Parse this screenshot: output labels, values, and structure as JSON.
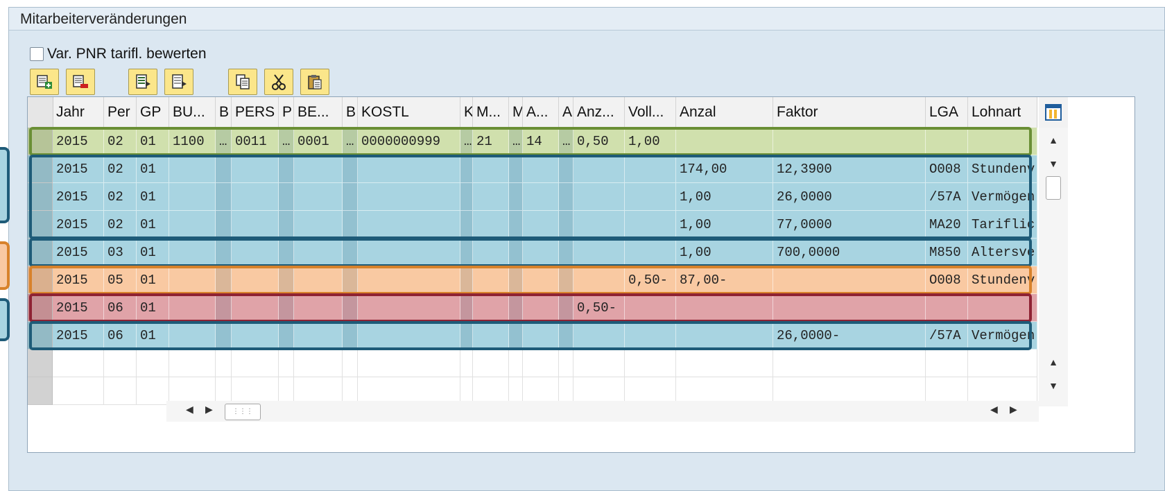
{
  "window": {
    "title": "Mitarbeiterveränderungen"
  },
  "checkbox": {
    "label": "Var. PNR tarifl. bewerten",
    "checked": false
  },
  "toolbar": {
    "buttons": [
      {
        "name": "append-row-icon"
      },
      {
        "name": "delete-row-icon"
      },
      {
        "name": "select-all-icon"
      },
      {
        "name": "deselect-all-icon"
      },
      {
        "name": "copy-icon"
      },
      {
        "name": "cut-icon"
      },
      {
        "name": "paste-icon"
      }
    ]
  },
  "table": {
    "headers": [
      "Jahr",
      "Per",
      "GP",
      "BU...",
      "B",
      "PERS",
      "P",
      "BE...",
      "B",
      "KOSTL",
      "K",
      "M...",
      "M",
      "A...",
      "A",
      "Anz...",
      "Voll...",
      "Anzal",
      "Faktor",
      "LGA",
      "Lohnart"
    ],
    "rows": [
      {
        "color": "green",
        "cells": [
          "2015",
          "02",
          "01",
          "1100",
          "…",
          "0011",
          "…",
          "0001",
          "…",
          "0000000999",
          "…",
          "21",
          "…",
          "14",
          "…",
          "0,50",
          "1,00",
          "",
          "",
          "",
          ""
        ]
      },
      {
        "color": "blue",
        "cells": [
          "2015",
          "02",
          "01",
          "",
          "",
          "",
          "",
          "",
          "",
          "",
          "",
          "",
          "",
          "",
          "",
          "",
          "",
          "174,00",
          "12,3900",
          "O008",
          "Stundenv"
        ]
      },
      {
        "color": "blue",
        "cells": [
          "2015",
          "02",
          "01",
          "",
          "",
          "",
          "",
          "",
          "",
          "",
          "",
          "",
          "",
          "",
          "",
          "",
          "",
          "1,00",
          "26,0000",
          "/57A",
          "Vermögen"
        ]
      },
      {
        "color": "blue",
        "cells": [
          "2015",
          "02",
          "01",
          "",
          "",
          "",
          "",
          "",
          "",
          "",
          "",
          "",
          "",
          "",
          "",
          "",
          "",
          "1,00",
          "77,0000",
          "MA20",
          "Tariflic"
        ]
      },
      {
        "color": "blue",
        "cells": [
          "2015",
          "03",
          "01",
          "",
          "",
          "",
          "",
          "",
          "",
          "",
          "",
          "",
          "",
          "",
          "",
          "",
          "",
          "1,00",
          "700,0000",
          "M850",
          "Altersve"
        ]
      },
      {
        "color": "orange",
        "cells": [
          "2015",
          "05",
          "01",
          "",
          "",
          "",
          "",
          "",
          "",
          "",
          "",
          "",
          "",
          "",
          "",
          "",
          "0,50-",
          "87,00-",
          "",
          "O008",
          "Stundenv"
        ]
      },
      {
        "color": "red",
        "cells": [
          "2015",
          "06",
          "01",
          "",
          "",
          "",
          "",
          "",
          "",
          "",
          "",
          "",
          "",
          "",
          "",
          "0,50-",
          "",
          "",
          "",
          "",
          ""
        ]
      },
      {
        "color": "blue",
        "cells": [
          "2015",
          "06",
          "01",
          "",
          "",
          "",
          "",
          "",
          "",
          "",
          "",
          "",
          "",
          "",
          "",
          "",
          "",
          "",
          "26,0000-",
          "/57A",
          "Vermögen"
        ]
      }
    ],
    "empty_rows": 2
  },
  "colors": {
    "green": "#d0e0ad",
    "blue": "#a8d4e1",
    "orange": "#f9c9a2",
    "red": "#e0a3a8",
    "empty": "#ffffff"
  }
}
